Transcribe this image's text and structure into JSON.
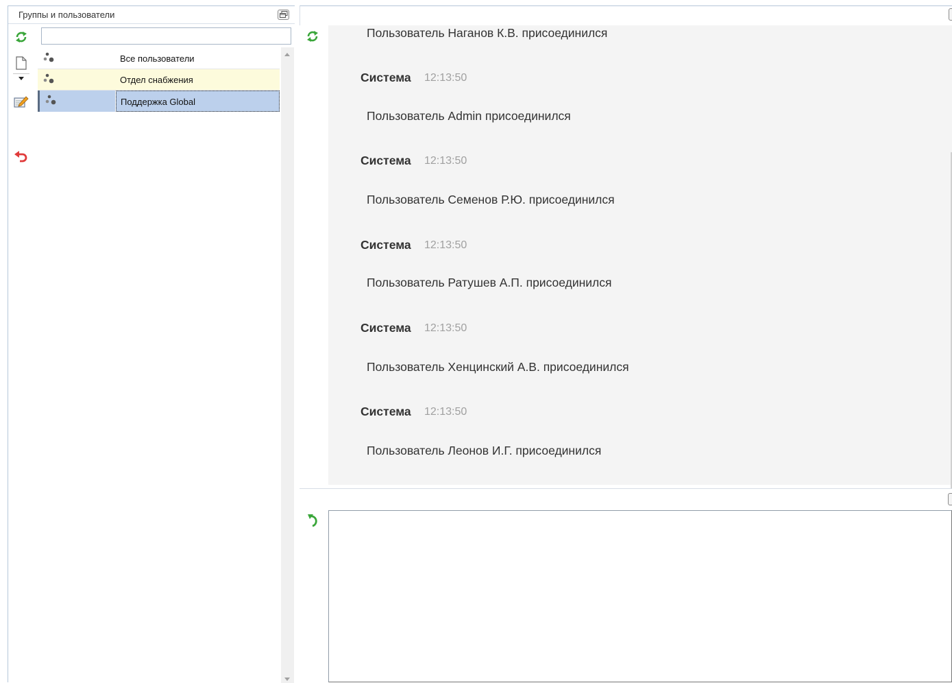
{
  "left_panel": {
    "title": "Группы и пользователи",
    "search": {
      "value": "",
      "placeholder": ""
    },
    "groups": [
      {
        "name": "Все пользователи"
      },
      {
        "name": "Отдел снабжения"
      },
      {
        "name": "Поддержка Global"
      }
    ],
    "icons": [
      "refresh-icon",
      "new-document-icon",
      "dropdown-arrow-icon",
      "edit-icon",
      "undo-icon",
      "group-icon"
    ]
  },
  "chat": {
    "messages": [
      {
        "text": "Пользователь Наганов К.В. присоединился"
      },
      {
        "author": "Система",
        "time": "12:13:50",
        "text": "Пользователь Admin присоединился"
      },
      {
        "author": "Система",
        "time": "12:13:50",
        "text": "Пользователь Семенов Р.Ю. присоединился"
      },
      {
        "author": "Система",
        "time": "12:13:50",
        "text": "Пользователь Ратушев А.П. присоединился"
      },
      {
        "author": "Система",
        "time": "12:13:50",
        "text": "Пользователь Хенцинский А.В. присоединился"
      },
      {
        "author": "Система",
        "time": "12:13:50",
        "text": "Пользователь Леонов И.Г. присоединился"
      }
    ]
  },
  "input": {
    "value": ""
  },
  "colors": {
    "refresh": "#3aa63a",
    "undo": "#e03b3b",
    "selected_row": "#bcd0ec",
    "hover_row": "#fdfbdc",
    "chat_bg": "#f4f4f4"
  }
}
